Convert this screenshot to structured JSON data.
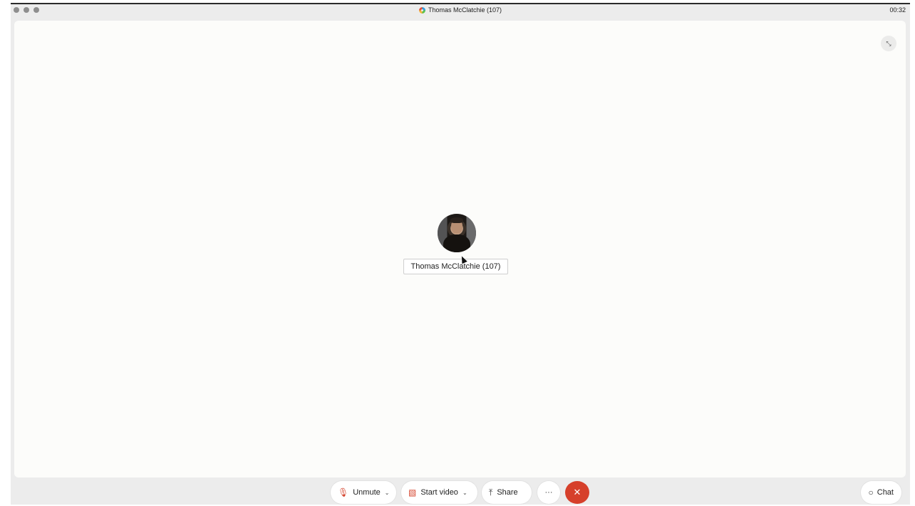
{
  "window": {
    "title": "Thomas McClatchie (107)",
    "timer": "00:32"
  },
  "stage": {
    "participant_name": "Thomas McClatchie (107)",
    "collapse_icon": "collapse-arrows-icon"
  },
  "controls": {
    "unmute_label": "Unmute",
    "start_video_label": "Start video",
    "share_label": "Share",
    "more_label": "···",
    "end_label": "✕",
    "chat_label": "Chat"
  },
  "icons": {
    "mic": "microphone-muted-icon",
    "video": "video-off-icon",
    "share": "share-screen-icon",
    "chat": "chat-bubble-icon"
  },
  "colors": {
    "end_call": "#d6402b",
    "muted_icon": "#d5442d",
    "stage_bg": "#fcfcfa"
  }
}
